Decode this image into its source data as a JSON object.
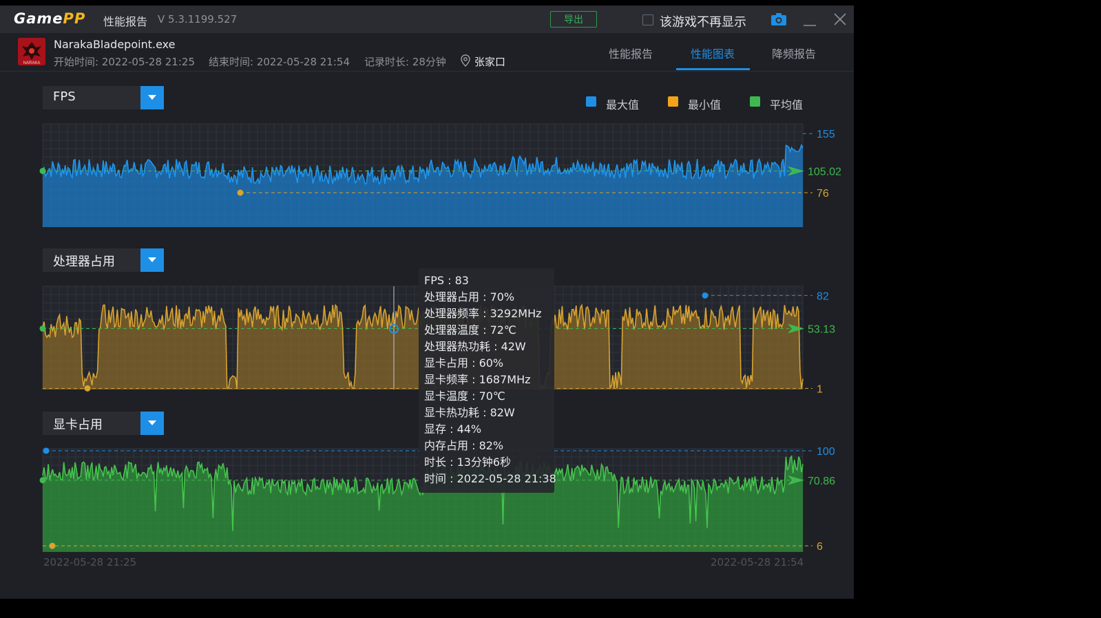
{
  "titlebar": {
    "logo_main": "Game",
    "logo_accent": "PP",
    "title": "性能报告",
    "version": "V 5.3.1199.527",
    "export_label": "导出",
    "hide_label": "该游戏不再显示",
    "hide_checked": false
  },
  "app": {
    "exe": "NarakaBladepoint.exe",
    "icon_text": "NARAKA",
    "start": "开始时间: 2022-05-28 21:25",
    "end": "结束时间: 2022-05-28 21:54",
    "duration": "记录时长: 28分钟",
    "location": "张家口"
  },
  "tabs": [
    {
      "label": "性能报告",
      "active": false
    },
    {
      "label": "性能图表",
      "active": true
    },
    {
      "label": "降频报告",
      "active": false
    }
  ],
  "legend": [
    {
      "label": "最大值",
      "color": "#1e8fe6"
    },
    {
      "label": "最小值",
      "color": "#f2a31b"
    },
    {
      "label": "平均值",
      "color": "#3fb94f"
    }
  ],
  "charts": [
    {
      "selector": "FPS",
      "max": "155",
      "avg": "105.02",
      "min": "76",
      "fill": "#1c7fd0",
      "line": "#1e96f0"
    },
    {
      "selector": "处理器占用",
      "max": "82",
      "avg": "53.13",
      "min": "1",
      "fill": "#8a6a2a",
      "line": "#d9a330"
    },
    {
      "selector": "显卡占用",
      "max": "100",
      "avg": "70.86",
      "min": "6",
      "fill": "#2f9a3c",
      "line": "#46c44e"
    }
  ],
  "tooltip": [
    "FPS : 83",
    "处理器占用 : 70%",
    "处理器频率 : 3292MHz",
    "处理器温度 : 72℃",
    "处理器热功耗 : 42W",
    "显卡占用 : 60%",
    "显卡频率 : 1687MHz",
    "显卡温度 : 70℃",
    "显卡热功耗 : 82W",
    "显存 : 44%",
    "内存占用 : 82%",
    "时长 : 13分钟6秒",
    "时间 : 2022-05-28 21:38"
  ],
  "x_axis": {
    "start": "2022-05-28 21:25",
    "end": "2022-05-28 21:54"
  }
}
